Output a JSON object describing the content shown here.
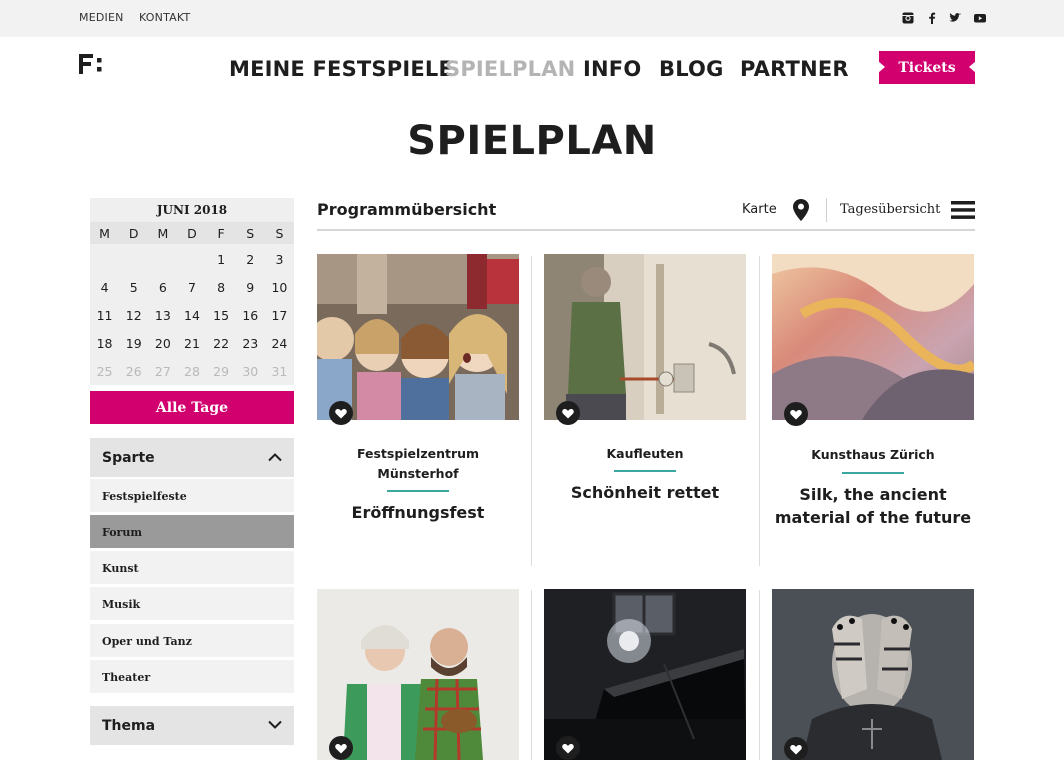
{
  "topbar": {
    "links": [
      "MEDIEN",
      "KONTAKT"
    ],
    "social_icons": [
      "instagram-icon",
      "facebook-icon",
      "twitter-icon",
      "youtube-icon"
    ]
  },
  "logo": {
    "text": "F:"
  },
  "nav": {
    "items": [
      "MEINE FESTSPIELE",
      "SPIELPLAN",
      "INFO",
      "BLOG",
      "PARTNER"
    ],
    "active": "SPIELPLAN"
  },
  "tickets_label": "Tickets",
  "page_title": "SPIELPLAN",
  "calendar": {
    "month": "JUNI 2018",
    "weekdays": [
      "M",
      "D",
      "M",
      "D",
      "F",
      "S",
      "S"
    ],
    "rows": [
      [
        "",
        "",
        "",
        "",
        "1",
        "2",
        "3"
      ],
      [
        "4",
        "5",
        "6",
        "7",
        "8",
        "9",
        "10"
      ],
      [
        "11",
        "12",
        "13",
        "14",
        "15",
        "16",
        "17"
      ],
      [
        "18",
        "19",
        "20",
        "21",
        "22",
        "23",
        "24"
      ],
      [
        "25",
        "26",
        "27",
        "28",
        "29",
        "30",
        "31"
      ]
    ],
    "dimmed_from": "25",
    "all_days_label": "Alle Tage"
  },
  "filters": {
    "sparte": {
      "label": "Sparte",
      "items": [
        "Festspielfeste",
        "Forum",
        "Kunst",
        "Musik",
        "Oper und Tanz",
        "Theater"
      ],
      "selected": "Forum"
    },
    "thema": {
      "label": "Thema"
    }
  },
  "program": {
    "title": "Programmübersicht",
    "map_label": "Karte",
    "day_view_label": "Tagesübersicht"
  },
  "cards": [
    {
      "venue": "Festspielzentrum Münsterhof",
      "title": "Eröffnungsfest"
    },
    {
      "venue": "Kaufleuten",
      "title": "Schönheit rettet"
    },
    {
      "venue": "Kunsthaus Zürich",
      "title": "Silk, the ancient material of the future"
    },
    {
      "venue": "",
      "title": ""
    },
    {
      "venue": "",
      "title": ""
    },
    {
      "venue": "",
      "title": ""
    }
  ],
  "colors": {
    "accent": "#d1006e",
    "rule": "#3aa8a0",
    "active_nav": "#b4b4b4"
  }
}
